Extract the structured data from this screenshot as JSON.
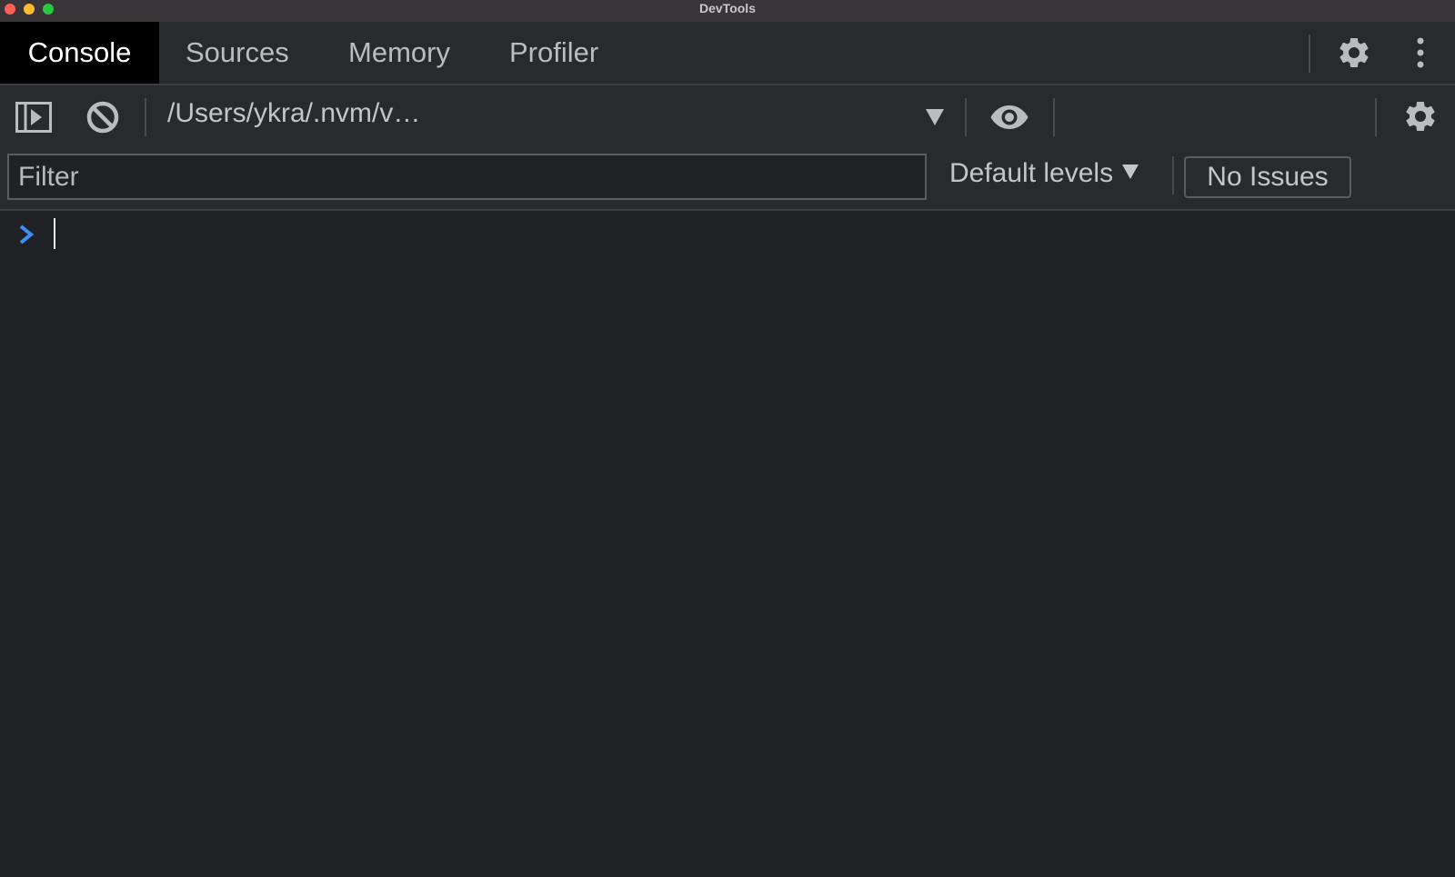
{
  "window": {
    "title": "DevTools"
  },
  "tabs": [
    {
      "label": "Console",
      "active": true
    },
    {
      "label": "Sources",
      "active": false
    },
    {
      "label": "Memory",
      "active": false
    },
    {
      "label": "Profiler",
      "active": false
    }
  ],
  "tabbar_icons": [
    "gear-icon",
    "kebab-menu-icon"
  ],
  "toolbar": {
    "sidebar_toggle_icon": "sidebar-play-icon",
    "clear_icon": "block-icon",
    "context_label": "/Users/ykra/.nvm/v…",
    "context_dropdown_icon": "triangle-down-icon",
    "live_expression_icon": "eye-icon",
    "settings_icon": "gear-icon"
  },
  "filter": {
    "placeholder": "Filter",
    "value": "",
    "levels_label": "Default levels",
    "issues_label": "No Issues"
  },
  "console": {
    "prompt_icon": "chevron-right-icon",
    "input_value": ""
  },
  "colors": {
    "background": "#202124",
    "toolbar_bg": "#292a2d",
    "active_tab_bg": "#000000",
    "prompt_accent": "#3f8ef5",
    "traffic_close": "#fe5f57",
    "traffic_min": "#febc2e",
    "traffic_max": "#28c840"
  }
}
